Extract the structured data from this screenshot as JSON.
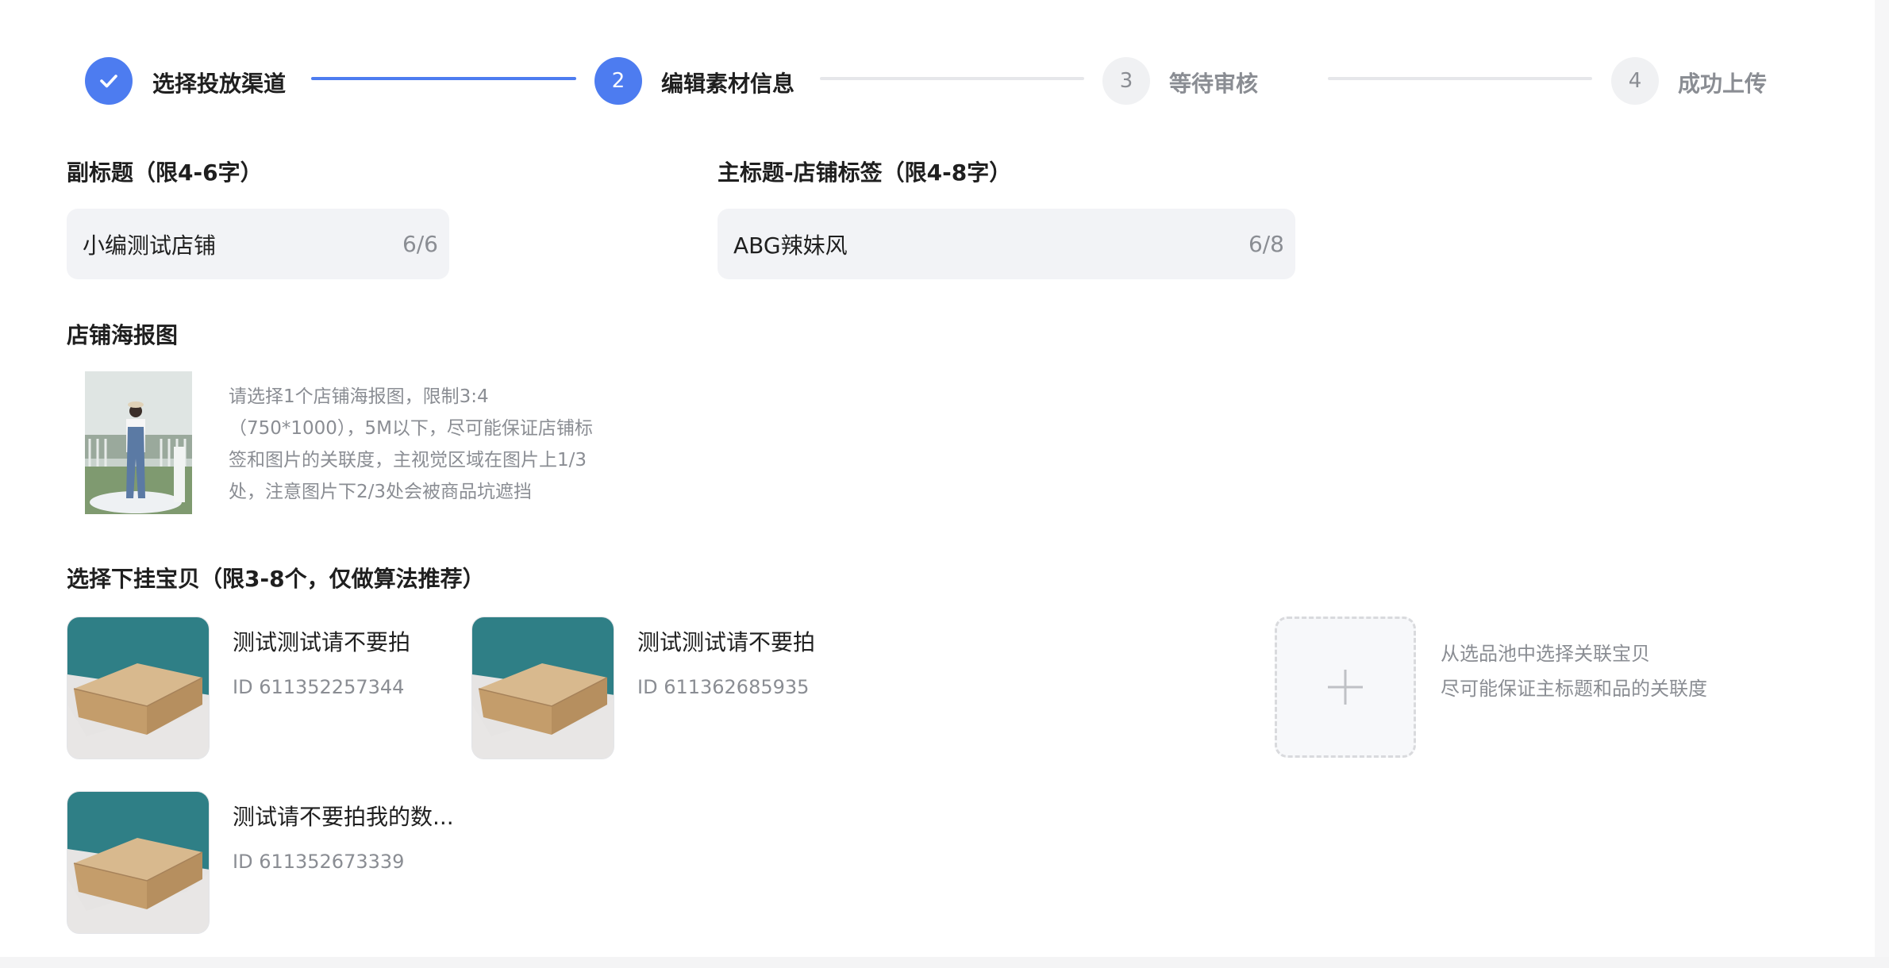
{
  "steps": [
    {
      "number": "1",
      "label": "选择投放渠道",
      "state": "done"
    },
    {
      "number": "2",
      "label": "编辑素材信息",
      "state": "active"
    },
    {
      "number": "3",
      "label": "等待审核",
      "state": "todo"
    },
    {
      "number": "4",
      "label": "成功上传",
      "state": "todo"
    }
  ],
  "form": {
    "subtitle": {
      "label": "副标题（限4-6字）",
      "value": "小编测试店铺",
      "count": "6/6"
    },
    "main_title": {
      "label": "主标题-店铺标签（限4-8字）",
      "value": "ABG辣妹风",
      "count": "6/8"
    },
    "poster": {
      "label": "店铺海报图",
      "hint_lines": [
        "请选择1个店铺海报图，限制3:4",
        "（750*1000），5M以下，尽可能保证店铺标",
        "签和图片的关联度，主视觉区域在图片上1/3",
        "处，注意图片下2/3处会被商品坑遮挡"
      ]
    },
    "products": {
      "label": "选择下挂宝贝（限3-8个，仅做算法推荐）",
      "items": [
        {
          "name": "测试测试请不要拍",
          "id": "ID 611352257344"
        },
        {
          "name": "测试测试请不要拍",
          "id": "ID 611362685935"
        },
        {
          "name": "测试请不要拍我的数...",
          "id": "ID 611352673339"
        }
      ],
      "add_hint_lines": [
        "从选品池中选择关联宝贝",
        "尽可能保证主标题和品的关联度"
      ]
    }
  },
  "colors": {
    "accent": "#4d7cf0",
    "muted": "#8a8d93",
    "field_bg": "#f2f3f6"
  }
}
